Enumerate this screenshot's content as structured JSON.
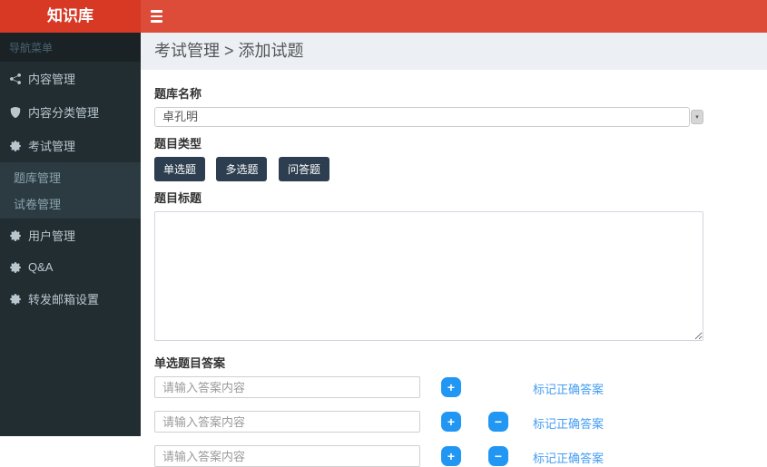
{
  "app": {
    "title": "知识库"
  },
  "sidebar": {
    "section_label": "导航菜单",
    "items": [
      {
        "label": "内容管理",
        "icon": "share-icon"
      },
      {
        "label": "内容分类管理",
        "icon": "shield-icon"
      },
      {
        "label": "考试管理",
        "icon": "gear-icon",
        "submenu": [
          "题库管理",
          "试卷管理"
        ]
      },
      {
        "label": "用户管理",
        "icon": "gear-icon"
      },
      {
        "label": "Q&A",
        "icon": "gear-icon"
      },
      {
        "label": "转发邮箱设置",
        "icon": "gear-icon"
      }
    ]
  },
  "breadcrumb": "考试管理 > 添加试题",
  "form": {
    "bank_label": "题库名称",
    "bank_value": "卓孔明",
    "dropdown_arrow": "▾",
    "type_label": "题目类型",
    "type_buttons": [
      "单选题",
      "多选题",
      "问答题"
    ],
    "title_label": "题目标题",
    "title_value": "",
    "answers_label": "单选题目答案",
    "answer_placeholder": "请输入答案内容",
    "add_label": "+",
    "remove_label": "−",
    "mark_correct_label": "标记正确答案",
    "answer_rows": [
      {
        "value": "",
        "has_remove": false
      },
      {
        "value": "",
        "has_remove": true
      },
      {
        "value": "",
        "has_remove": true
      }
    ]
  },
  "colors": {
    "navbar_red": "#dd4b39",
    "logo_red": "#d73925",
    "sidebar_dark": "#222d32",
    "submenu_dark": "#2c3b41",
    "breadcrumb_gray": "#ecf0f5",
    "dark_button": "#2c3e50",
    "action_blue": "#2196f3",
    "link_blue": "#459df2"
  }
}
